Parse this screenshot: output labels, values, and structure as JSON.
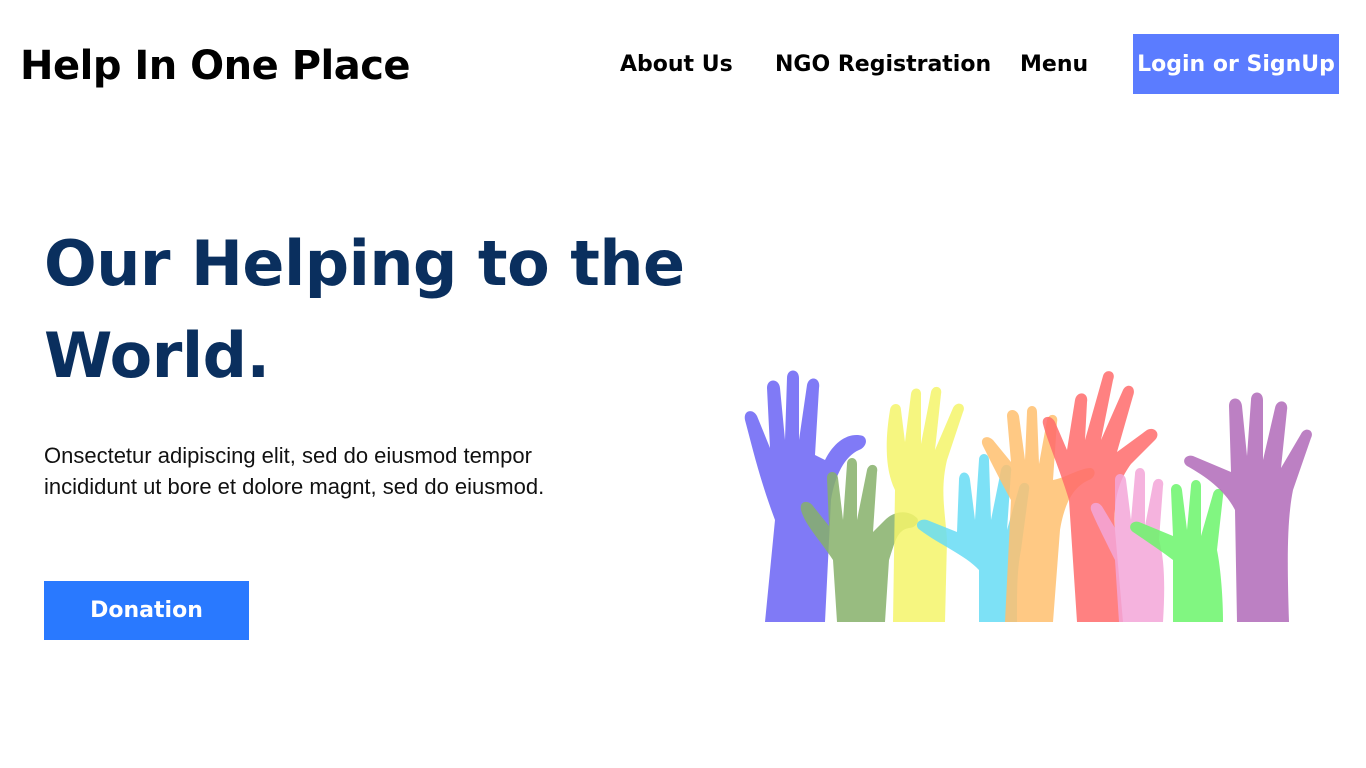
{
  "header": {
    "brand": "Help In One Place",
    "nav": {
      "about": "About Us",
      "ngo": "NGO Registration",
      "menu": "Menu"
    },
    "login_label": "Login or SignUp"
  },
  "hero": {
    "title": "Our Helping to the World.",
    "description": "Onsectetur adipiscing elit, sed do eiusmod tempor incididunt ut bore et dolore magnt, sed do eiusmod.",
    "donate_label": "Donation"
  },
  "illustration": {
    "name": "raised-hands-illustration",
    "colors": [
      "#6a63f5",
      "#86b06a",
      "#f5f56a",
      "#66dcf5",
      "#ffc06e",
      "#ff6b6b",
      "#f3a6d8",
      "#6bf56b",
      "#b06ab8"
    ]
  },
  "colors": {
    "login_button": "#5b7cff",
    "donate_button": "#2979ff",
    "title": "#0a2f5e"
  }
}
